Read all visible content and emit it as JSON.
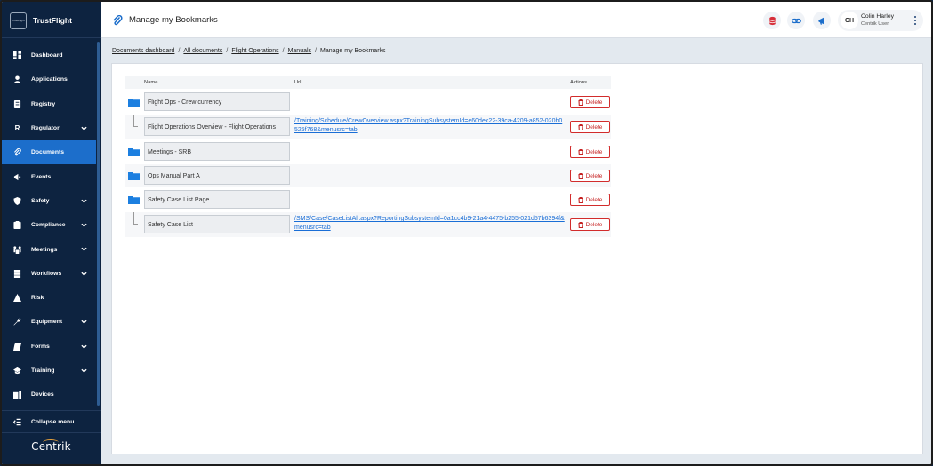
{
  "brand": {
    "name": "TrustFlight",
    "mark": "TrustFlight"
  },
  "sidebar": {
    "items": [
      {
        "label": "Dashboard",
        "icon": "dashboard-icon",
        "expandable": false,
        "active": false
      },
      {
        "label": "Applications",
        "icon": "person-icon",
        "expandable": false,
        "active": false
      },
      {
        "label": "Registry",
        "icon": "registry-icon",
        "expandable": false,
        "active": false
      },
      {
        "label": "Regulator",
        "icon": "r-letter-icon",
        "expandable": true,
        "active": false
      },
      {
        "label": "Documents",
        "icon": "paperclip-icon",
        "expandable": false,
        "active": true
      },
      {
        "label": "Events",
        "icon": "megaphone-icon",
        "expandable": false,
        "active": false
      },
      {
        "label": "Safety",
        "icon": "shield-icon",
        "expandable": true,
        "active": false
      },
      {
        "label": "Compliance",
        "icon": "compliance-icon",
        "expandable": true,
        "active": false
      },
      {
        "label": "Meetings",
        "icon": "meetings-icon",
        "expandable": true,
        "active": false
      },
      {
        "label": "Workflows",
        "icon": "workflow-icon",
        "expandable": true,
        "active": false
      },
      {
        "label": "Risk",
        "icon": "warning-icon",
        "expandable": false,
        "active": false
      },
      {
        "label": "Equipment",
        "icon": "wrench-icon",
        "expandable": true,
        "active": false
      },
      {
        "label": "Forms",
        "icon": "forms-icon",
        "expandable": true,
        "active": false
      },
      {
        "label": "Training",
        "icon": "graduation-cap-icon",
        "expandable": true,
        "active": false
      },
      {
        "label": "Devices",
        "icon": "devices-icon",
        "expandable": false,
        "active": false
      }
    ],
    "collapse_label": "Collapse menu",
    "logo_text": "Centrik"
  },
  "header": {
    "title": "Manage my Bookmarks",
    "user": {
      "initials": "CH",
      "name": "Colin Harley",
      "role": "Centrik User"
    }
  },
  "breadcrumb": {
    "items": [
      "Documents dashboard",
      "All documents",
      "Flight Operations",
      "Manuals"
    ],
    "current": "Manage my Bookmarks"
  },
  "table": {
    "columns": {
      "name": "Name",
      "url": "Url",
      "actions": "Actions"
    },
    "delete_label": "Delete",
    "rows": [
      {
        "type": "folder",
        "name": "Flight Ops - Crew currency",
        "url": ""
      },
      {
        "type": "link",
        "name": "Flight Operations Overview - Flight Operations",
        "url": "/Training/Schedule/CrewOverview.aspx?TrainingSubsystemId=e60dec22-39ca-4209-a852-020b0525f768&menusrc=tab"
      },
      {
        "type": "folder",
        "name": "Meetings - SRB",
        "url": ""
      },
      {
        "type": "folder",
        "name": "Ops Manual Part A",
        "url": ""
      },
      {
        "type": "folder",
        "name": "Safety Case List Page",
        "url": ""
      },
      {
        "type": "link",
        "name": "Safety Case List",
        "url": "/SMS/Case/CaseListAll.aspx?ReportingSubsystemId=0a1cc4b9-21a4-4475-b255-021d57b6394f&menusrc=tab"
      }
    ]
  },
  "colors": {
    "sidebar_bg": "#0d2340",
    "active_item": "#1c6ecb",
    "link": "#1a6ed6",
    "delete": "#c62222",
    "folder": "#1c7fe0"
  }
}
